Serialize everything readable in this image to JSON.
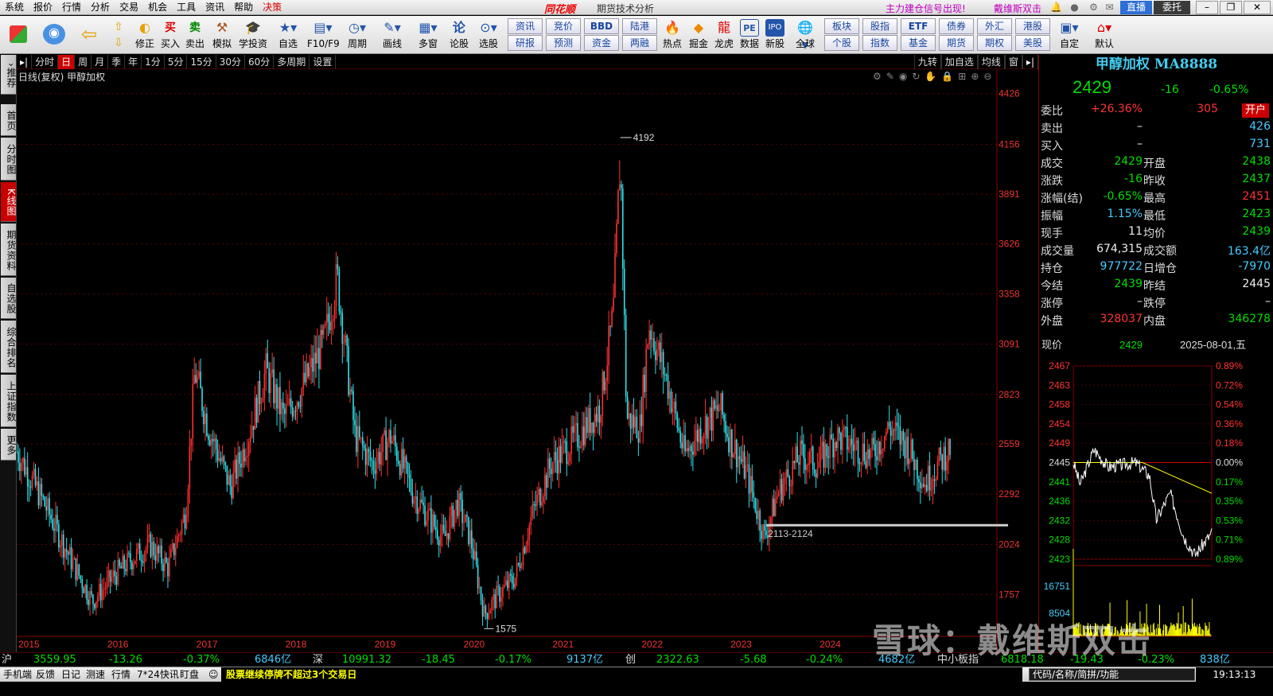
{
  "menu": [
    "系统",
    "报价",
    "行情",
    "分析",
    "交易",
    "机会",
    "工具",
    "资讯",
    "帮助",
    "决策"
  ],
  "app": {
    "logo": "同花顺",
    "title": "期货技术分析",
    "ad1": "主力建仓信号出现!",
    "ad2": "戴维斯双击",
    "live": "直播",
    "wt": "委托"
  },
  "toolbar": [
    "修正",
    "买入",
    "卖出",
    "模拟",
    "学投资",
    "自选",
    "F10/F9",
    "周期",
    "画线",
    "多窗",
    "论股",
    "选股",
    "热点",
    "掘金",
    "龙虎",
    "数据",
    "新股",
    "全球",
    "自定",
    "默认"
  ],
  "toolbar_small": [
    [
      "资讯",
      "研报"
    ],
    [
      "竞价",
      "预测"
    ],
    [
      "BBD",
      "资金"
    ],
    [
      "陆港",
      "两融"
    ],
    [
      "板块",
      "个股"
    ],
    [
      "股指",
      "指数"
    ],
    [
      "ETF",
      "基金"
    ],
    [
      "债券",
      "期货"
    ],
    [
      "外汇",
      "期权"
    ],
    [
      "港股",
      "美股"
    ]
  ],
  "left_tabs": [
    "推荐",
    "首页",
    "分时图",
    "K线图",
    "期货资料",
    "自选股",
    "综合排名",
    "上证指数",
    "更多"
  ],
  "period_bar": [
    "分时",
    "日",
    "周",
    "月",
    "季",
    "年",
    "1分",
    "5分",
    "15分",
    "30分",
    "60分",
    "多周期",
    "设置"
  ],
  "period_right": [
    "九转",
    "加自选",
    "均线",
    "窗"
  ],
  "chart_info": "日线(复权)  甲醇加权",
  "chart_data": {
    "type": "candlestick",
    "title": "甲醇加权",
    "years": [
      "2015",
      "2016",
      "2017",
      "2018",
      "2019",
      "2020",
      "2021",
      "2022",
      "2023",
      "2024"
    ],
    "y_ticks": [
      4426,
      4156,
      3891,
      3626,
      3358,
      3091,
      2823,
      2559,
      2292,
      2024,
      1757
    ],
    "ylim": [
      1500,
      4480
    ],
    "annotations": [
      {
        "label": "4192",
        "value": 4192
      },
      {
        "label": "1575",
        "value": 1575
      },
      {
        "label": "2113-2124",
        "value": 2124
      }
    ],
    "series": [
      {
        "year": 2015.0,
        "close": 2520
      },
      {
        "year": 2015.3,
        "close": 2250
      },
      {
        "year": 2015.6,
        "close": 1950
      },
      {
        "year": 2015.85,
        "close": 1720
      },
      {
        "year": 2016.1,
        "close": 1860
      },
      {
        "year": 2016.3,
        "close": 1950
      },
      {
        "year": 2016.5,
        "close": 2020
      },
      {
        "year": 2016.7,
        "close": 1900
      },
      {
        "year": 2016.9,
        "close": 2200
      },
      {
        "year": 2017.0,
        "close": 2950
      },
      {
        "year": 2017.15,
        "close": 2650
      },
      {
        "year": 2017.4,
        "close": 2330
      },
      {
        "year": 2017.6,
        "close": 2600
      },
      {
        "year": 2017.8,
        "close": 2950
      },
      {
        "year": 2018.0,
        "close": 2700
      },
      {
        "year": 2018.2,
        "close": 2850
      },
      {
        "year": 2018.45,
        "close": 3100
      },
      {
        "year": 2018.6,
        "close": 3450
      },
      {
        "year": 2018.8,
        "close": 2600
      },
      {
        "year": 2019.0,
        "close": 2450
      },
      {
        "year": 2019.2,
        "close": 2600
      },
      {
        "year": 2019.45,
        "close": 2300
      },
      {
        "year": 2019.65,
        "close": 2150
      },
      {
        "year": 2019.8,
        "close": 2050
      },
      {
        "year": 2019.95,
        "close": 2250
      },
      {
        "year": 2020.1,
        "close": 2050
      },
      {
        "year": 2020.25,
        "close": 1650
      },
      {
        "year": 2020.4,
        "close": 1750
      },
      {
        "year": 2020.6,
        "close": 1850
      },
      {
        "year": 2020.8,
        "close": 2200
      },
      {
        "year": 2021.0,
        "close": 2450
      },
      {
        "year": 2021.3,
        "close": 2600
      },
      {
        "year": 2021.55,
        "close": 2750
      },
      {
        "year": 2021.7,
        "close": 3250
      },
      {
        "year": 2021.78,
        "close": 4100
      },
      {
        "year": 2021.85,
        "close": 2700
      },
      {
        "year": 2022.0,
        "close": 2650
      },
      {
        "year": 2022.1,
        "close": 3200
      },
      {
        "year": 2022.3,
        "close": 2900
      },
      {
        "year": 2022.5,
        "close": 2500
      },
      {
        "year": 2022.7,
        "close": 2650
      },
      {
        "year": 2022.9,
        "close": 2750
      },
      {
        "year": 2023.0,
        "close": 2600
      },
      {
        "year": 2023.2,
        "close": 2400
      },
      {
        "year": 2023.4,
        "close": 2060
      },
      {
        "year": 2023.55,
        "close": 2300
      },
      {
        "year": 2023.8,
        "close": 2500
      },
      {
        "year": 2024.0,
        "close": 2450
      },
      {
        "year": 2024.2,
        "close": 2600
      },
      {
        "year": 2024.4,
        "close": 2550
      },
      {
        "year": 2024.6,
        "close": 2500
      },
      {
        "year": 2024.8,
        "close": 2650
      },
      {
        "year": 2025.0,
        "close": 2550
      },
      {
        "year": 2025.2,
        "close": 2350
      },
      {
        "year": 2025.35,
        "close": 2450
      },
      {
        "year": 2025.5,
        "close": 2550
      }
    ]
  },
  "quote": {
    "title": "甲醇加权 MA8888",
    "price": "2429",
    "change": "-16",
    "pct": "-0.65%",
    "rows": [
      {
        "k": "委比",
        "v": "+26.36%",
        "vc": "red",
        "k2": "",
        "v2": "305",
        "v2c": "red"
      },
      {
        "k": "卖出",
        "v": "–",
        "vc": "white",
        "k2": "",
        "v2": "426",
        "v2c": "cyan"
      },
      {
        "k": "买入",
        "v": "–",
        "vc": "white",
        "k2": "",
        "v2": "731",
        "v2c": "cyan"
      },
      {
        "k": "成交",
        "v": "2429",
        "vc": "green",
        "k2": "开盘",
        "v2": "2438",
        "v2c": "green"
      },
      {
        "k": "涨跌",
        "v": "-16",
        "vc": "green",
        "k2": "昨收",
        "v2": "2437",
        "v2c": "green"
      },
      {
        "k": "涨幅(结)",
        "v": "-0.65%",
        "vc": "green",
        "k2": "最高",
        "v2": "2451",
        "v2c": "red"
      },
      {
        "k": "振幅",
        "v": "1.15%",
        "vc": "cyan",
        "k2": "最低",
        "v2": "2423",
        "v2c": "green"
      },
      {
        "k": "现手",
        "v": "11",
        "vc": "white",
        "k2": "均价",
        "v2": "2439",
        "v2c": "green"
      },
      {
        "k": "成交量",
        "v": "674,315",
        "vc": "white",
        "k2": "成交额",
        "v2": "163.4亿",
        "v2c": "cyan"
      },
      {
        "k": "持仓",
        "v": "977722",
        "vc": "cyan",
        "k2": "日增仓",
        "v2": "-7970",
        "v2c": "cyan"
      },
      {
        "k": "今结",
        "v": "2439",
        "vc": "green",
        "k2": "昨结",
        "v2": "2445",
        "v2c": "white"
      },
      {
        "k": "涨停",
        "v": "–",
        "vc": "white",
        "k2": "跌停",
        "v2": "–",
        "v2c": "white"
      },
      {
        "k": "外盘",
        "v": "328037",
        "vc": "red",
        "k2": "内盘",
        "v2": "346278",
        "v2c": "green"
      }
    ],
    "open_btn": "开户"
  },
  "mini": {
    "label": "现价",
    "price": "2429",
    "date": "2025-08-01,五",
    "prices": [
      "2467",
      "2463",
      "2458",
      "2454",
      "2449",
      "2445",
      "2441",
      "2436",
      "2432",
      "2428",
      "2423"
    ],
    "pcts": [
      "0.89%",
      "0.72%",
      "0.54%",
      "0.36%",
      "0.18%",
      "0.00%",
      "0.17%",
      "0.35%",
      "0.53%",
      "0.71%",
      "0.89%"
    ],
    "vols": [
      "16751",
      "8504"
    ]
  },
  "bottom": {
    "sh": {
      "name": "沪",
      "idx": "3559.95",
      "chg": "-13.26",
      "pct": "-0.37%",
      "amt": "6846亿"
    },
    "sz": {
      "name": "深",
      "idx": "10991.32",
      "chg": "-18.45",
      "pct": "-0.17%",
      "amt": "9137亿"
    },
    "cy": {
      "name": "创",
      "idx": "2322.63",
      "chg": "-5.68",
      "pct": "-0.24%",
      "amt": "4682亿"
    },
    "zx": {
      "name": "中小板指",
      "idx": "6818.18",
      "chg": "-19.43",
      "pct": "-0.23%",
      "amt": "838亿"
    }
  },
  "status": {
    "items": [
      "手机端",
      "反馈",
      "日记",
      "测速",
      "行情",
      "7*24快讯",
      "盯盘"
    ],
    "news": "股票继续停牌不超过3个交易日",
    "code": "代码/名称/简拼/功能",
    "clock": "19:13:13"
  },
  "watermark": "雪球：戴维斯双击"
}
